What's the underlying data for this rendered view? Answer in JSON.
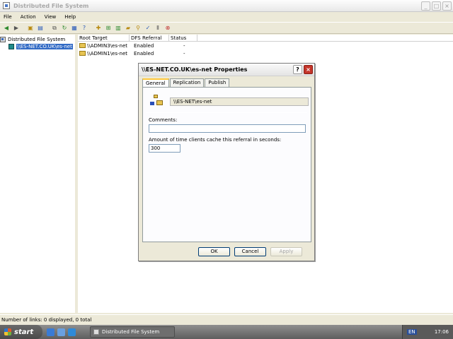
{
  "window": {
    "title": "Distributed File System"
  },
  "menu": [
    "File",
    "Action",
    "View",
    "Help"
  ],
  "toolbar_icons": [
    "back-arrow-icon",
    "forward-arrow-icon",
    "up-folder-icon",
    "show-hide-tree-icon",
    "copy-icon",
    "refresh-icon",
    "export-icon",
    "help-icon",
    "new-root-icon",
    "new-link-icon",
    "properties-icon",
    "open-icon",
    "filter-icon",
    "check-status-icon",
    "stop-icon"
  ],
  "tree": {
    "root_label": "Distributed File System",
    "child_label": "\\\\ES-NET.CO.UK\\es-net"
  },
  "list": {
    "columns": [
      "Root Target",
      "DFS Referral",
      "Status"
    ],
    "rows": [
      {
        "target": "\\\\ADMIN3\\es-net",
        "referral": "Enabled",
        "status": "-"
      },
      {
        "target": "\\\\ADMIN1\\es-net",
        "referral": "Enabled",
        "status": "-"
      }
    ]
  },
  "statusbar": {
    "text": "Number of links: 0 displayed, 0 total"
  },
  "taskbar": {
    "start_label": "start",
    "task_label": "Distributed File System",
    "lang": "EN",
    "clock": "17:06"
  },
  "dialog": {
    "title": "\\\\ES-NET.CO.UK\\es-net Properties",
    "tabs": [
      "General",
      "Replication",
      "Publish"
    ],
    "path": "\\\\ES-NET\\es-net",
    "comments_label": "Comments:",
    "comments_value": "",
    "cache_label": "Amount of time clients cache this referral in seconds:",
    "cache_value": "300",
    "ok_label": "OK",
    "cancel_label": "Cancel",
    "apply_label": "Apply"
  }
}
